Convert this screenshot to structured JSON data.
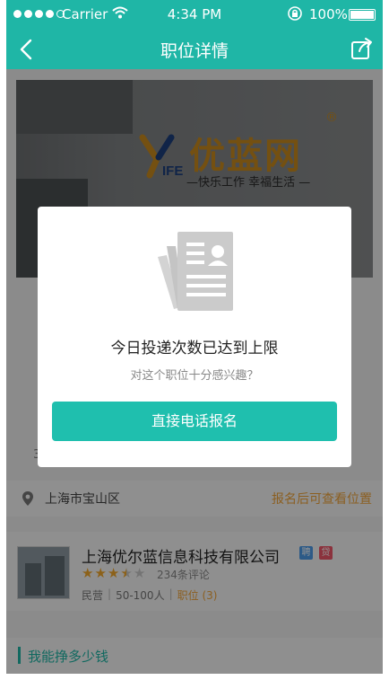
{
  "status_bar": {
    "carrier": "Carrier",
    "time": "4:34 PM",
    "battery": "100%"
  },
  "nav": {
    "title": "职位详情"
  },
  "banner": {
    "brand": "优蓝网",
    "reg_mark": "®",
    "slogan": "—快乐工作 幸福生活 —"
  },
  "partial_row_text": "3",
  "location": {
    "address": "上海市宝山区",
    "hint": "报名后可查看位置"
  },
  "company": {
    "name": "上海优尔蓝信息科技有限公司",
    "tag_hiring": "聘",
    "tag_loan": "贷",
    "rating": 3.5,
    "reviews": "234条评论",
    "type": "民营",
    "size": "50-100人",
    "jobs": "职位 (3)"
  },
  "section": {
    "title": "我能挣多少钱"
  },
  "modal": {
    "title": "今日投递次数已达到上限",
    "subtitle": "对这个职位十分感兴趣？",
    "button_label": "直接电话报名"
  },
  "colors": {
    "accent": "#1fb6a6",
    "button": "#1fbfae",
    "highlight": "#f0a43a"
  }
}
